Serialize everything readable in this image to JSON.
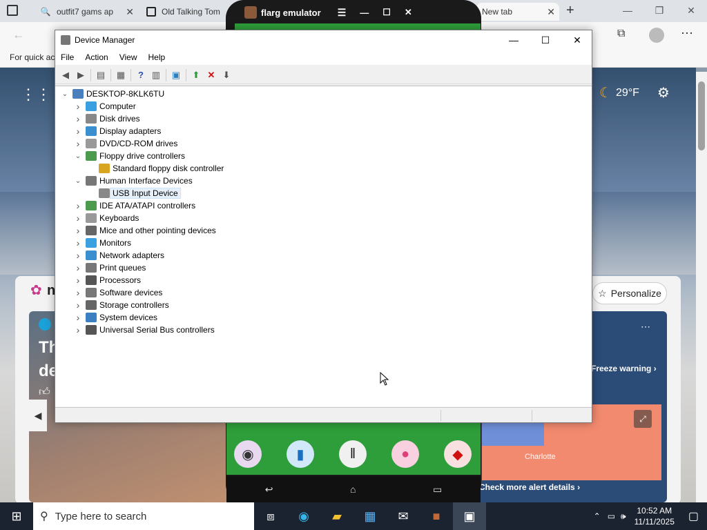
{
  "browser": {
    "tabs": [
      {
        "label": "outfit7 gams ap",
        "icon": "search-icon"
      },
      {
        "label": "Old Talking Tom",
        "icon": "page-icon"
      },
      {
        "label": "New tab",
        "icon": "newtab-icon"
      }
    ],
    "new_tab_symbol": "+",
    "favorites_text": "For quick ac"
  },
  "newtab": {
    "weather_temp": "29°F",
    "personalize_label": "Personalize",
    "news_headline_1": "Th",
    "news_headline_2": "de",
    "alert_label": "Freeze warning",
    "alert_link": "Check more alert details",
    "map_city": "Charlotte",
    "brand_initial": "n"
  },
  "emulator": {
    "title": "flarg emulator"
  },
  "device_manager": {
    "title": "Device Manager",
    "menu": [
      "File",
      "Action",
      "View",
      "Help"
    ],
    "tree": [
      {
        "label": "DESKTOP-8KLK6TU",
        "level": 0,
        "expanded": true,
        "color": "#4a7fbf"
      },
      {
        "label": "Computer",
        "level": 1,
        "expanded": false,
        "color": "#3aa0e0"
      },
      {
        "label": "Disk drives",
        "level": 1,
        "expanded": false,
        "color": "#888888"
      },
      {
        "label": "Display adapters",
        "level": 1,
        "expanded": false,
        "color": "#3a8fd0"
      },
      {
        "label": "DVD/CD-ROM drives",
        "level": 1,
        "expanded": false,
        "color": "#999999"
      },
      {
        "label": "Floppy drive controllers",
        "level": 1,
        "expanded": true,
        "color": "#4c9a4c"
      },
      {
        "label": "Standard floppy disk controller",
        "level": 2,
        "expanded": null,
        "color": "#d9a520"
      },
      {
        "label": "Human Interface Devices",
        "level": 1,
        "expanded": true,
        "color": "#777777"
      },
      {
        "label": "USB Input Device",
        "level": 2,
        "expanded": null,
        "color": "#888888",
        "selected": true
      },
      {
        "label": "IDE ATA/ATAPI controllers",
        "level": 1,
        "expanded": false,
        "color": "#4c9a4c"
      },
      {
        "label": "Keyboards",
        "level": 1,
        "expanded": false,
        "color": "#999999"
      },
      {
        "label": "Mice and other pointing devices",
        "level": 1,
        "expanded": false,
        "color": "#666666"
      },
      {
        "label": "Monitors",
        "level": 1,
        "expanded": false,
        "color": "#3aa0e0"
      },
      {
        "label": "Network adapters",
        "level": 1,
        "expanded": false,
        "color": "#3a8fd0"
      },
      {
        "label": "Print queues",
        "level": 1,
        "expanded": false,
        "color": "#777777"
      },
      {
        "label": "Processors",
        "level": 1,
        "expanded": false,
        "color": "#555555"
      },
      {
        "label": "Software devices",
        "level": 1,
        "expanded": false,
        "color": "#777777"
      },
      {
        "label": "Storage controllers",
        "level": 1,
        "expanded": false,
        "color": "#666666"
      },
      {
        "label": "System devices",
        "level": 1,
        "expanded": false,
        "color": "#3a7fc0"
      },
      {
        "label": "Universal Serial Bus controllers",
        "level": 1,
        "expanded": false,
        "color": "#555555"
      }
    ]
  },
  "taskbar": {
    "search_placeholder": "Type here to search",
    "time": "10:52 AM",
    "date": "11/11/2025"
  },
  "colors": {
    "selection": "#e5f0fb",
    "taskbar": "#1b2330",
    "emulator_green": "#2e9e3a"
  }
}
